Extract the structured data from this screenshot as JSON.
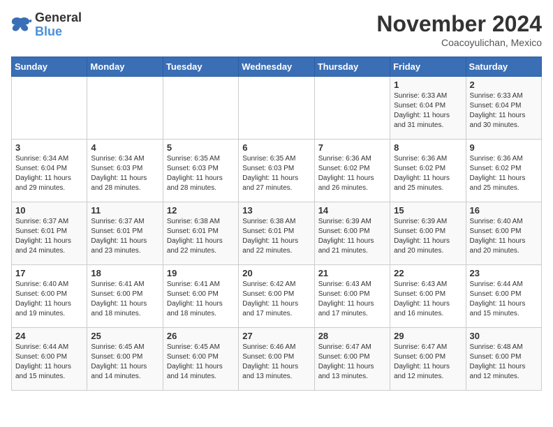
{
  "header": {
    "logo_line1": "General",
    "logo_line2": "Blue",
    "month_title": "November 2024",
    "location": "Coacoyulichan, Mexico"
  },
  "days_of_week": [
    "Sunday",
    "Monday",
    "Tuesday",
    "Wednesday",
    "Thursday",
    "Friday",
    "Saturday"
  ],
  "weeks": [
    [
      {
        "day": "",
        "sunrise": "",
        "sunset": "",
        "daylight": "",
        "empty": true
      },
      {
        "day": "",
        "sunrise": "",
        "sunset": "",
        "daylight": "",
        "empty": true
      },
      {
        "day": "",
        "sunrise": "",
        "sunset": "",
        "daylight": "",
        "empty": true
      },
      {
        "day": "",
        "sunrise": "",
        "sunset": "",
        "daylight": "",
        "empty": true
      },
      {
        "day": "",
        "sunrise": "",
        "sunset": "",
        "daylight": "",
        "empty": true
      },
      {
        "day": "1",
        "sunrise": "Sunrise: 6:33 AM",
        "sunset": "Sunset: 6:04 PM",
        "daylight": "Daylight: 11 hours and 31 minutes."
      },
      {
        "day": "2",
        "sunrise": "Sunrise: 6:33 AM",
        "sunset": "Sunset: 6:04 PM",
        "daylight": "Daylight: 11 hours and 30 minutes."
      }
    ],
    [
      {
        "day": "3",
        "sunrise": "Sunrise: 6:34 AM",
        "sunset": "Sunset: 6:04 PM",
        "daylight": "Daylight: 11 hours and 29 minutes."
      },
      {
        "day": "4",
        "sunrise": "Sunrise: 6:34 AM",
        "sunset": "Sunset: 6:03 PM",
        "daylight": "Daylight: 11 hours and 28 minutes."
      },
      {
        "day": "5",
        "sunrise": "Sunrise: 6:35 AM",
        "sunset": "Sunset: 6:03 PM",
        "daylight": "Daylight: 11 hours and 28 minutes."
      },
      {
        "day": "6",
        "sunrise": "Sunrise: 6:35 AM",
        "sunset": "Sunset: 6:03 PM",
        "daylight": "Daylight: 11 hours and 27 minutes."
      },
      {
        "day": "7",
        "sunrise": "Sunrise: 6:36 AM",
        "sunset": "Sunset: 6:02 PM",
        "daylight": "Daylight: 11 hours and 26 minutes."
      },
      {
        "day": "8",
        "sunrise": "Sunrise: 6:36 AM",
        "sunset": "Sunset: 6:02 PM",
        "daylight": "Daylight: 11 hours and 25 minutes."
      },
      {
        "day": "9",
        "sunrise": "Sunrise: 6:36 AM",
        "sunset": "Sunset: 6:02 PM",
        "daylight": "Daylight: 11 hours and 25 minutes."
      }
    ],
    [
      {
        "day": "10",
        "sunrise": "Sunrise: 6:37 AM",
        "sunset": "Sunset: 6:01 PM",
        "daylight": "Daylight: 11 hours and 24 minutes."
      },
      {
        "day": "11",
        "sunrise": "Sunrise: 6:37 AM",
        "sunset": "Sunset: 6:01 PM",
        "daylight": "Daylight: 11 hours and 23 minutes."
      },
      {
        "day": "12",
        "sunrise": "Sunrise: 6:38 AM",
        "sunset": "Sunset: 6:01 PM",
        "daylight": "Daylight: 11 hours and 22 minutes."
      },
      {
        "day": "13",
        "sunrise": "Sunrise: 6:38 AM",
        "sunset": "Sunset: 6:01 PM",
        "daylight": "Daylight: 11 hours and 22 minutes."
      },
      {
        "day": "14",
        "sunrise": "Sunrise: 6:39 AM",
        "sunset": "Sunset: 6:00 PM",
        "daylight": "Daylight: 11 hours and 21 minutes."
      },
      {
        "day": "15",
        "sunrise": "Sunrise: 6:39 AM",
        "sunset": "Sunset: 6:00 PM",
        "daylight": "Daylight: 11 hours and 20 minutes."
      },
      {
        "day": "16",
        "sunrise": "Sunrise: 6:40 AM",
        "sunset": "Sunset: 6:00 PM",
        "daylight": "Daylight: 11 hours and 20 minutes."
      }
    ],
    [
      {
        "day": "17",
        "sunrise": "Sunrise: 6:40 AM",
        "sunset": "Sunset: 6:00 PM",
        "daylight": "Daylight: 11 hours and 19 minutes."
      },
      {
        "day": "18",
        "sunrise": "Sunrise: 6:41 AM",
        "sunset": "Sunset: 6:00 PM",
        "daylight": "Daylight: 11 hours and 18 minutes."
      },
      {
        "day": "19",
        "sunrise": "Sunrise: 6:41 AM",
        "sunset": "Sunset: 6:00 PM",
        "daylight": "Daylight: 11 hours and 18 minutes."
      },
      {
        "day": "20",
        "sunrise": "Sunrise: 6:42 AM",
        "sunset": "Sunset: 6:00 PM",
        "daylight": "Daylight: 11 hours and 17 minutes."
      },
      {
        "day": "21",
        "sunrise": "Sunrise: 6:43 AM",
        "sunset": "Sunset: 6:00 PM",
        "daylight": "Daylight: 11 hours and 17 minutes."
      },
      {
        "day": "22",
        "sunrise": "Sunrise: 6:43 AM",
        "sunset": "Sunset: 6:00 PM",
        "daylight": "Daylight: 11 hours and 16 minutes."
      },
      {
        "day": "23",
        "sunrise": "Sunrise: 6:44 AM",
        "sunset": "Sunset: 6:00 PM",
        "daylight": "Daylight: 11 hours and 15 minutes."
      }
    ],
    [
      {
        "day": "24",
        "sunrise": "Sunrise: 6:44 AM",
        "sunset": "Sunset: 6:00 PM",
        "daylight": "Daylight: 11 hours and 15 minutes."
      },
      {
        "day": "25",
        "sunrise": "Sunrise: 6:45 AM",
        "sunset": "Sunset: 6:00 PM",
        "daylight": "Daylight: 11 hours and 14 minutes."
      },
      {
        "day": "26",
        "sunrise": "Sunrise: 6:45 AM",
        "sunset": "Sunset: 6:00 PM",
        "daylight": "Daylight: 11 hours and 14 minutes."
      },
      {
        "day": "27",
        "sunrise": "Sunrise: 6:46 AM",
        "sunset": "Sunset: 6:00 PM",
        "daylight": "Daylight: 11 hours and 13 minutes."
      },
      {
        "day": "28",
        "sunrise": "Sunrise: 6:47 AM",
        "sunset": "Sunset: 6:00 PM",
        "daylight": "Daylight: 11 hours and 13 minutes."
      },
      {
        "day": "29",
        "sunrise": "Sunrise: 6:47 AM",
        "sunset": "Sunset: 6:00 PM",
        "daylight": "Daylight: 11 hours and 12 minutes."
      },
      {
        "day": "30",
        "sunrise": "Sunrise: 6:48 AM",
        "sunset": "Sunset: 6:00 PM",
        "daylight": "Daylight: 11 hours and 12 minutes."
      }
    ]
  ]
}
